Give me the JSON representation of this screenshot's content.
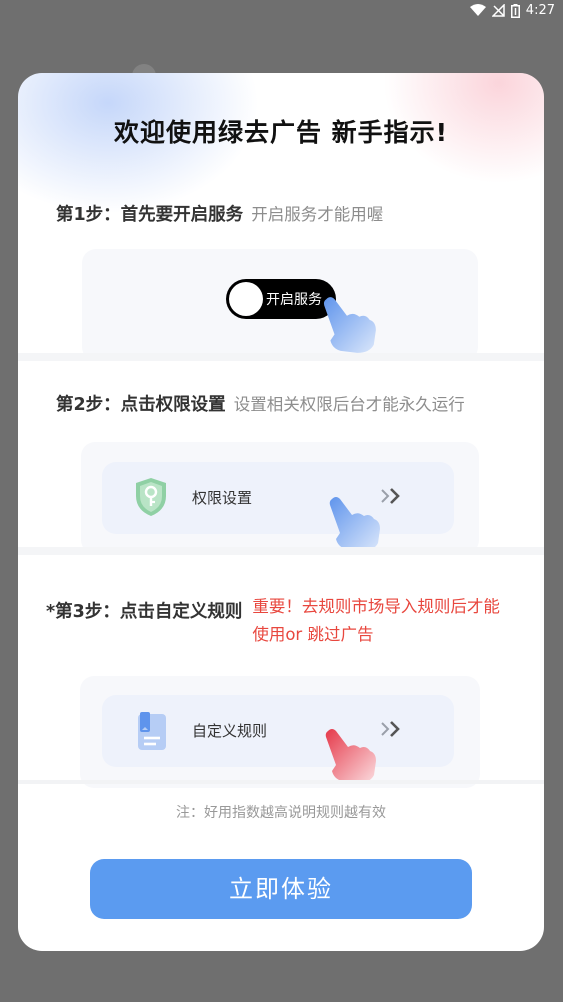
{
  "status_bar": {
    "time": "4:27",
    "icons": [
      "wifi-icon",
      "signal-off-icon",
      "battery-icon"
    ]
  },
  "dialog": {
    "title": "欢迎使用绿去广告 新手指示!",
    "step1": {
      "label": "第1步：首先要开启服务",
      "hint": "开启服务才能用喔",
      "toggle_label": "开启服务"
    },
    "step2": {
      "label": "第2步：点击权限设置",
      "hint": "设置相关权限后台才能永久运行",
      "card_label": "权限设置",
      "card_icon": "shield-key-icon"
    },
    "step3": {
      "label": "*第3步：点击自定义规则",
      "hint": "重要！去规则市场导入规则后才能使用or 跳过广告",
      "card_label": "自定义规则",
      "card_icon": "document-icon"
    },
    "note": "注：好用指数越高说明规则越有效",
    "cta_label": "立即体验"
  },
  "colors": {
    "overlay": "#6f6f6f",
    "accent_blue": "#5b9bf0",
    "warning_red": "#e8473e",
    "toggle_bg": "#000000",
    "shield_green": "#8fd0a4"
  }
}
